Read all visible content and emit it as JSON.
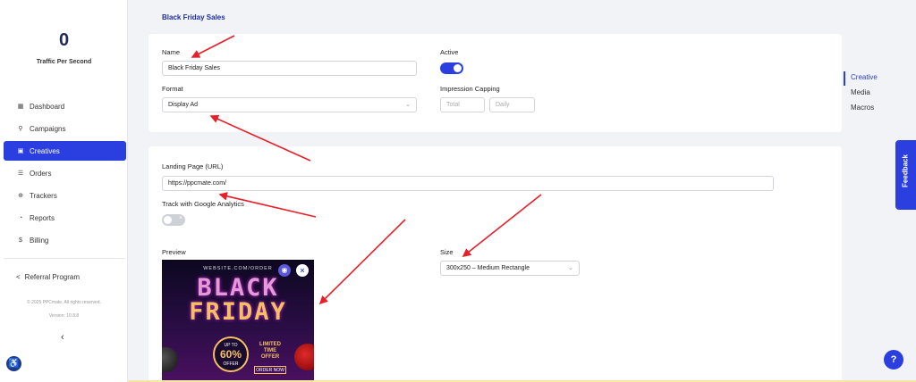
{
  "sidebar": {
    "traffic_value": "0",
    "traffic_label": "Traffic Per Second",
    "items": [
      {
        "label": "Dashboard",
        "icon": "grid-icon"
      },
      {
        "label": "Campaigns",
        "icon": "megaphone-icon"
      },
      {
        "label": "Creatives",
        "icon": "image-icon"
      },
      {
        "label": "Orders",
        "icon": "list-icon"
      },
      {
        "label": "Trackers",
        "icon": "crosshair-icon"
      },
      {
        "label": "Reports",
        "icon": "pie-chart-icon"
      },
      {
        "label": "Billing",
        "icon": "dollar-icon"
      }
    ],
    "active_item": "Creatives",
    "referral_label": "Referral Program",
    "copyright": "© 2025 PPCmate. All rights reserved.",
    "version": "Version: 10.8.8",
    "collapse_glyph": "‹",
    "accessibility_glyph": "♿"
  },
  "page": {
    "title": "Black Friday Sales"
  },
  "form": {
    "name_label": "Name",
    "name_value": "Black Friday Sales",
    "active_label": "Active",
    "active_value": true,
    "format_label": "Format",
    "format_value": "Display Ad",
    "impression_capping_label": "Impression Capping",
    "total_placeholder": "Total",
    "daily_placeholder": "Daily",
    "landing_label": "Landing Page (URL)",
    "landing_value": "https://ppcmate.com/",
    "ga_label": "Track with Google Analytics",
    "ga_value": false,
    "preview_label": "Preview",
    "size_label": "Size",
    "size_value": "300x250 – Medium Rectangle"
  },
  "ad_preview": {
    "site": "WEBSITE.COM/ORDER",
    "line1": "BLACK",
    "line2": "FRIDAY",
    "up_to": "UP TO",
    "percent": "60%",
    "off": "OFFER",
    "limited": "LIMITED",
    "time": "TIME",
    "offer": "OFFER",
    "order_now": "ORDER NOW"
  },
  "right_nav": {
    "items": [
      "Creative",
      "Media",
      "Macros"
    ],
    "active": "Creative"
  },
  "feedback_label": "Feedback",
  "help_glyph": "?",
  "colors": {
    "accent": "#2b3fe0",
    "annotation_arrow": "#e8202a"
  }
}
